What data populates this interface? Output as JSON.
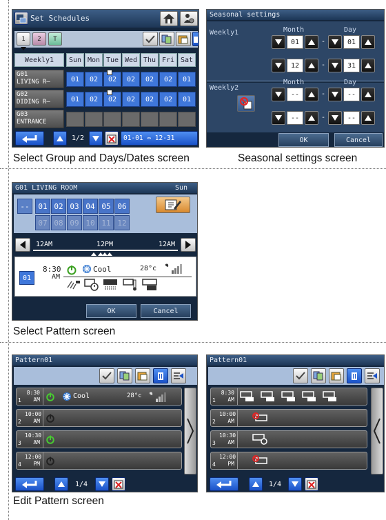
{
  "captions": {
    "select_group": "Select Group and Days/Dates screen",
    "seasonal": "Seasonal settings screen",
    "select_pattern": "Select Pattern screen",
    "edit_pattern": "Edit Pattern screen"
  },
  "schedules": {
    "title": "Set Schedules",
    "group_tabs": [
      "1",
      "2"
    ],
    "mode_label": "Weekly1",
    "days": [
      "Sun",
      "Mon",
      "Tue",
      "Wed",
      "Thu",
      "Fri",
      "Sat"
    ],
    "rows": [
      {
        "id": "G01",
        "name": "LIVING R–",
        "cells": [
          "01",
          "02",
          "02",
          "02",
          "02",
          "02",
          "01"
        ]
      },
      {
        "id": "G02",
        "name": "DIDING R–",
        "cells": [
          "01",
          "02",
          "02",
          "02",
          "02",
          "02",
          "01"
        ]
      },
      {
        "id": "G03",
        "name": "ENTRANCE",
        "cells": [
          "",
          "",
          "",
          "",
          "",
          "",
          ""
        ]
      }
    ],
    "page": "1/2",
    "range": "01-01 ⇔ 12-31"
  },
  "seasonal": {
    "title": "Seasonal settings",
    "weekly1": {
      "label": "Weekly1",
      "month_label": "Month",
      "day_label": "Day",
      "start_month": "01",
      "start_day": "01",
      "end_month": "12",
      "end_day": "31"
    },
    "weekly2": {
      "label": "Weekly2",
      "month_label": "Month",
      "day_label": "Day",
      "start_month": "--",
      "start_day": "--",
      "end_month": "--",
      "end_day": "--"
    },
    "dash": "-",
    "ok": "OK",
    "cancel": "Cancel"
  },
  "pattern": {
    "title": "G01 LIVING ROOM",
    "day": "Sun",
    "clear": "--",
    "patterns_row1": [
      "01",
      "02",
      "03",
      "04",
      "05",
      "06"
    ],
    "patterns_row2": [
      "07",
      "08",
      "09",
      "10",
      "11",
      "12"
    ],
    "timeline": [
      "12AM",
      "12PM",
      "12AM"
    ],
    "detail": {
      "num": "01",
      "time": "8:30",
      "ampm": "AM",
      "mode": "Cool",
      "temp": "28°c"
    },
    "ok": "OK",
    "cancel": "Cancel"
  },
  "edit": {
    "title": "Pattern01",
    "rows": [
      {
        "n": "1",
        "time": "8:30",
        "ampm": "AM",
        "mode": "Cool",
        "temp": "28°c"
      },
      {
        "n": "2",
        "time": "10:00",
        "ampm": "AM"
      },
      {
        "n": "3",
        "time": "10:30",
        "ampm": "AM"
      },
      {
        "n": "4",
        "time": "12:00",
        "ampm": "PM"
      }
    ],
    "page": "1/4"
  },
  "colors": {
    "accent": "#3f77da",
    "panel": "#15273e",
    "title_bar": "#2b4a72",
    "power_on": "#48c832",
    "prohibit": "#e02828"
  }
}
